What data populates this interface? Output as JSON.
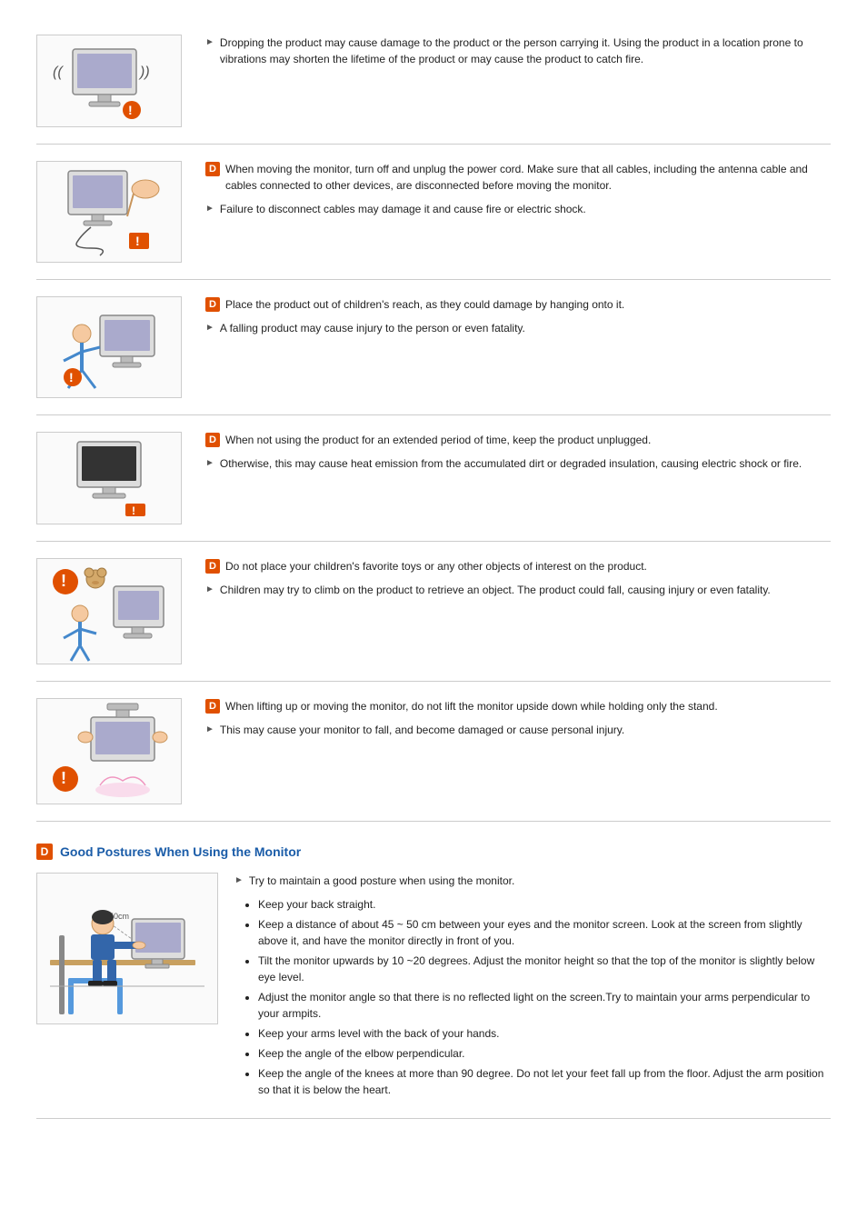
{
  "sections": [
    {
      "id": "section1",
      "mainPoints": [
        "Dropping the product may cause damage to the product or the person carrying it. Using the product in a location prone to vibrations may shorten the lifetime of the product or may cause the product to catch fire."
      ],
      "subPoints": []
    },
    {
      "id": "section2",
      "mainPoints": [
        "When moving the monitor, turn off and unplug the power cord. Make sure that all cables, including the antenna cable and cables connected to other devices, are disconnected before moving the monitor."
      ],
      "subPoints": [
        "Failure to disconnect cables may damage it and cause fire or electric shock."
      ]
    },
    {
      "id": "section3",
      "mainPoints": [
        "Place the product out of children's reach, as they could damage by hanging onto it."
      ],
      "subPoints": [
        "A falling product may cause injury to the person or even fatality."
      ]
    },
    {
      "id": "section4",
      "mainPoints": [
        "When not using the product for an extended period of time, keep the product unplugged."
      ],
      "subPoints": [
        "Otherwise, this may cause heat emission from the accumulated dirt or degraded insulation, causing electric shock or fire."
      ]
    },
    {
      "id": "section5",
      "mainPoints": [
        "Do not place your children's favorite toys or any other objects of interest on the product."
      ],
      "subPoints": [
        "Children may try to climb on the product to retrieve an object. The product could fall, causing injury or even fatality."
      ]
    },
    {
      "id": "section6",
      "mainPoints": [
        "When lifting up or moving the monitor, do not lift the monitor upside down while holding only the stand."
      ],
      "subPoints": [
        "This may cause your monitor to fall, and become damaged or cause personal injury."
      ]
    }
  ],
  "goodPosture": {
    "title": "Good Postures When Using the Monitor",
    "mainPoint": "Try to maintain a good posture when using the monitor.",
    "subPoints": [
      "Keep your back straight.",
      "Keep a distance of about 45 ~ 50 cm between your eyes and the monitor screen. Look at the screen from slightly above it, and have the monitor directly in front of you.",
      "Tilt the monitor upwards by 10 ~20 degrees. Adjust the monitor height so that the top of the monitor is slightly below eye level.",
      "Adjust the monitor angle so that there is no reflected light on the screen.Try to maintain your arms perpendicular to your armpits.",
      "Keep your arms level with the back of your hands.",
      "Keep the angle of the elbow perpendicular.",
      "Keep the angle of the knees at more than 90 degree. Do not let your feet fall up from the floor. Adjust the arm position so that it is below the heart."
    ]
  }
}
